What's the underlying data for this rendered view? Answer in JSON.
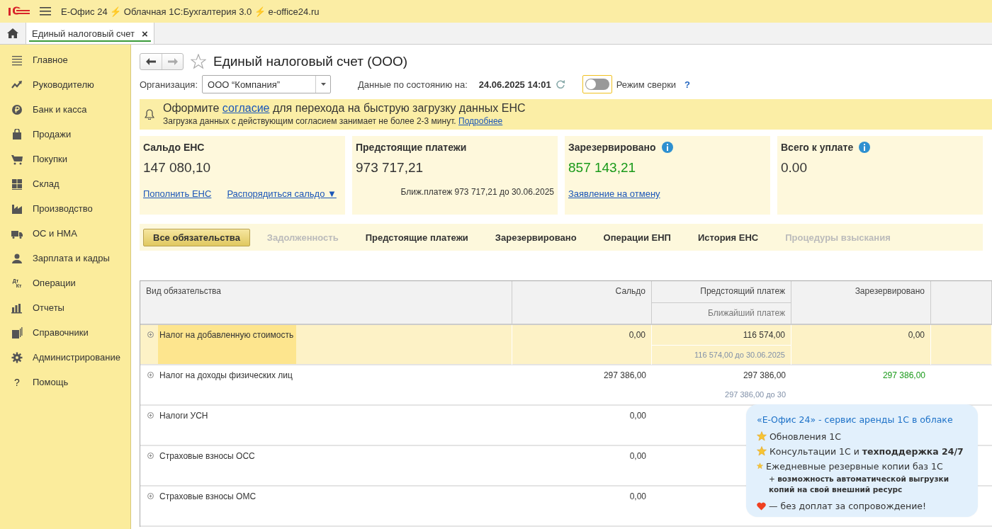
{
  "app_title": "Е-Офис 24 ⚡ Облачная 1С:Бухгалтерия 3.0 ⚡ e-office24.ru",
  "tabs": [
    {
      "label": "Единый налоговый счет",
      "selected": true,
      "close": "×"
    }
  ],
  "sidebar": {
    "items": [
      {
        "label": "Главное"
      },
      {
        "label": "Руководителю"
      },
      {
        "label": "Банк и касса"
      },
      {
        "label": "Продажи"
      },
      {
        "label": "Покупки"
      },
      {
        "label": "Склад"
      },
      {
        "label": "Производство"
      },
      {
        "label": "ОС и НМА"
      },
      {
        "label": "Зарплата и кадры"
      },
      {
        "label": "Операции",
        "icon_text": [
          "Дт",
          "Кт"
        ]
      },
      {
        "label": "Отчеты"
      },
      {
        "label": "Справочники"
      },
      {
        "label": "Администрирование"
      },
      {
        "label": "Помощь",
        "icon_text": [
          "?"
        ]
      }
    ]
  },
  "form": {
    "title": "Единый налоговый счет (ООО)",
    "favorite": false,
    "org_label": "Организация:",
    "org_value": "ООО “Компания”",
    "date_label": "Данные по состоянию на:",
    "date_value": "24.06.2025 14:01",
    "reconcile": {
      "label": "Режим сверки",
      "on": false,
      "help": "?"
    }
  },
  "notice": {
    "before": "Оформите ",
    "link": "согласие",
    "after": " для перехода на быструю загрузку данных ЕНС",
    "sub": "Загрузка данных с действующим согласием занимает не более 2-3 минут. ",
    "sub_link": "Подробнее"
  },
  "cards": [
    {
      "title": "Сальдо ЕНС",
      "info": false,
      "amount": "147 080,10",
      "positive": false,
      "links": [
        "Пополнить ЕНС",
        "Распорядиться сальдо ▼"
      ]
    },
    {
      "title": "Предстоящие платежи",
      "info": false,
      "amount": "973 717,21",
      "positive": false,
      "note": "Ближ.платеж 973 717,21 до 30.06.2025"
    },
    {
      "title": "Зарезервировано",
      "info": true,
      "amount": "857 143,21",
      "positive": true,
      "links": [
        "Заявление на отмену"
      ]
    },
    {
      "title": "Всего к уплате",
      "info": true,
      "amount": "0.00",
      "positive": false
    }
  ],
  "filters": [
    {
      "label": "Все обязательства",
      "selected": true,
      "disabled": false
    },
    {
      "label": "Задолженность",
      "selected": false,
      "disabled": true
    },
    {
      "label": "Предстоящие платежи",
      "selected": false,
      "disabled": false
    },
    {
      "label": "Зарезервировано",
      "selected": false,
      "disabled": false
    },
    {
      "label": "Операции ЕНП",
      "selected": false,
      "disabled": false
    },
    {
      "label": "История ЕНС",
      "selected": false,
      "disabled": false
    },
    {
      "label": "Процедуры взыскания",
      "selected": false,
      "disabled": true
    }
  ],
  "table": {
    "columns": [
      "Вид обязательства",
      "Сальдо",
      "Предстоящий платеж",
      "Зарезервировано"
    ],
    "subcolumn": "Ближайший платеж",
    "rows": [
      {
        "name": "Налог на добавленную стоимость",
        "selected": true,
        "saldo": "0,00",
        "upcoming": "116 574,00",
        "nearest": "116 574,00 до 30.06.2025",
        "reserved": "0,00",
        "reserved_positive": false
      },
      {
        "name": "Налог на доходы физических лиц",
        "selected": false,
        "saldo": "297 386,00",
        "upcoming": "297 386,00",
        "nearest": "297 386,00 до 30",
        "reserved": "297 386,00",
        "reserved_positive": true
      },
      {
        "name": "Налоги УСН",
        "selected": false,
        "saldo": "0,00"
      },
      {
        "name": "Страховые взносы ОСС",
        "selected": false,
        "saldo": "0,00"
      },
      {
        "name": "Страховые взносы ОМС",
        "selected": false,
        "saldo": "0,00"
      }
    ]
  },
  "promo": {
    "title": "«Е-Офис 24» - сервис аренды 1С в облаке",
    "items": [
      {
        "text": "Обновления 1С"
      },
      {
        "text": "Консультации 1С и **техподдержка 24/7**"
      },
      {
        "text": "Ежедневные резервные копии баз 1С",
        "note": "+ **возможность автоматической выгрузки копий на свой внешний ресурс**"
      }
    ],
    "footer": "— без доплат за сопровождение!"
  }
}
